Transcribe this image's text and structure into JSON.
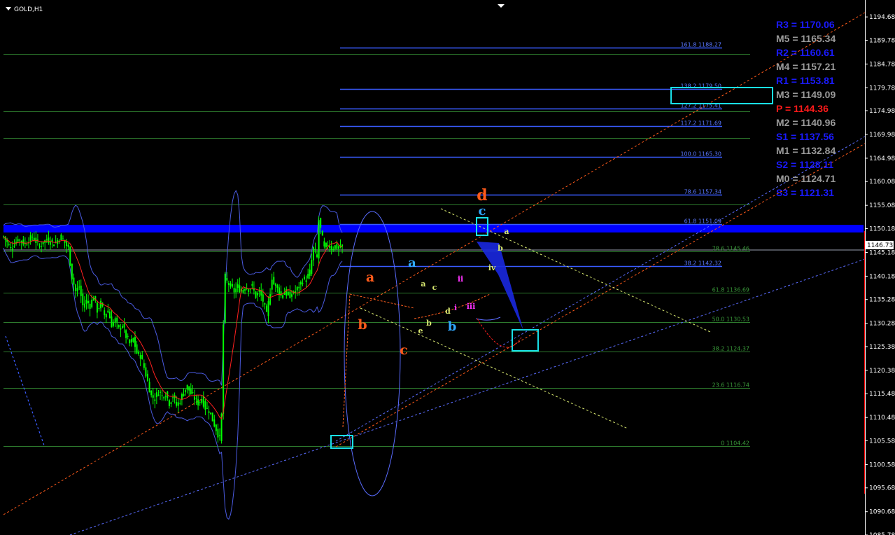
{
  "chart_data": {
    "type": "candlestick",
    "title": "GOLD,H1",
    "ylim": [
      1085.78,
      1197.5
    ],
    "y_ticks": [
      "1194.68",
      "1189.78",
      "1184.78",
      "1179.78",
      "1174.98",
      "1169.98",
      "1164.98",
      "1160.08",
      "1155.08",
      "1150.18",
      "1145.18",
      "1140.18",
      "1135.28",
      "1130.28",
      "1125.38",
      "1120.38",
      "1115.48",
      "1110.48",
      "1105.58",
      "1100.58",
      "1095.68",
      "1090.68",
      "1085.78"
    ],
    "current_price": "1146.73",
    "price_path": [
      [
        0,
        1148.5
      ],
      [
        4,
        1146
      ],
      [
        8,
        1148
      ],
      [
        12,
        1147
      ],
      [
        16,
        1148.5
      ],
      [
        20,
        1146.5
      ],
      [
        24,
        1148
      ],
      [
        28,
        1147
      ],
      [
        32,
        1148.5
      ],
      [
        36,
        1146
      ],
      [
        38,
        1140
      ],
      [
        40,
        1137
      ],
      [
        42,
        1138
      ],
      [
        44,
        1134
      ],
      [
        46,
        1135
      ],
      [
        48,
        1134
      ],
      [
        50,
        1136
      ],
      [
        52,
        1133
      ],
      [
        54,
        1134.5
      ],
      [
        56,
        1132
      ],
      [
        58,
        1133
      ],
      [
        60,
        1130
      ],
      [
        62,
        1131
      ],
      [
        64,
        1129
      ],
      [
        66,
        1130
      ],
      [
        68,
        1127.5
      ],
      [
        70,
        1126
      ],
      [
        72,
        1127
      ],
      [
        74,
        1124
      ],
      [
        76,
        1123.5
      ],
      [
        78,
        1121
      ],
      [
        80,
        1118
      ],
      [
        82,
        1115
      ],
      [
        84,
        1114.5
      ],
      [
        86,
        1116
      ],
      [
        88,
        1115
      ],
      [
        90,
        1115.5
      ],
      [
        92,
        1113.5
      ],
      [
        94,
        1115
      ],
      [
        96,
        1113
      ],
      [
        98,
        1114
      ],
      [
        100,
        1116
      ],
      [
        102,
        1117
      ],
      [
        104,
        1115.5
      ],
      [
        106,
        1114.5
      ],
      [
        108,
        1113.5
      ],
      [
        110,
        1114.5
      ],
      [
        112,
        1112.5
      ],
      [
        114,
        1112
      ],
      [
        116,
        1110
      ],
      [
        118,
        1108
      ],
      [
        120,
        1106
      ],
      [
        121,
        1111
      ],
      [
        122,
        1130
      ],
      [
        123,
        1140
      ],
      [
        124,
        1139
      ],
      [
        126,
        1138
      ],
      [
        128,
        1137
      ],
      [
        130,
        1138
      ],
      [
        132,
        1137
      ],
      [
        134,
        1138
      ],
      [
        136,
        1137.5
      ],
      [
        138,
        1138
      ],
      [
        140,
        1136
      ],
      [
        142,
        1137
      ],
      [
        144,
        1135
      ],
      [
        146,
        1132
      ],
      [
        148,
        1137
      ],
      [
        149,
        1140
      ],
      [
        150,
        1138.5
      ],
      [
        152,
        1138
      ],
      [
        154,
        1136
      ],
      [
        156,
        1137
      ],
      [
        158,
        1136
      ],
      [
        160,
        1136.5
      ],
      [
        162,
        1137
      ],
      [
        164,
        1138
      ],
      [
        166,
        1139.5
      ],
      [
        168,
        1139.5
      ],
      [
        170,
        1141
      ],
      [
        172,
        1146
      ],
      [
        174,
        1144
      ],
      [
        175,
        1152
      ],
      [
        177,
        1148
      ],
      [
        178,
        1146
      ],
      [
        180,
        1147
      ],
      [
        182,
        1146
      ],
      [
        184,
        1146.5
      ],
      [
        186,
        1146
      ],
      [
        188,
        1146.5
      ]
    ],
    "fibonacci_levels": [
      {
        "label": "161.8 1188.27",
        "price": 1188.27,
        "set": "blue"
      },
      {
        "label": "138.2 1179.50",
        "price": 1179.5,
        "set": "blue"
      },
      {
        "label": "127.2 1175.41",
        "price": 1175.41,
        "set": "blue"
      },
      {
        "label": "117.2 1171.69",
        "price": 1171.69,
        "set": "blue"
      },
      {
        "label": "100.0  1165.30",
        "price": 1165.3,
        "set": "blue"
      },
      {
        "label": "78.6 1157.34",
        "price": 1157.34,
        "set": "blue"
      },
      {
        "label": "61.8 1151.09",
        "price": 1151.09,
        "set": "blue"
      },
      {
        "label": "38.2 1142.32",
        "price": 1142.32,
        "set": "blue"
      },
      {
        "label": "78.6 1145.46",
        "price": 1145.46,
        "set": "green"
      },
      {
        "label": "61.8 1136.69",
        "price": 1136.69,
        "set": "green"
      },
      {
        "label": "50.0 1130.53",
        "price": 1130.53,
        "set": "green"
      },
      {
        "label": "38.2 1124.37",
        "price": 1124.37,
        "set": "green"
      },
      {
        "label": "23.6 1116.74",
        "price": 1116.74,
        "set": "green"
      },
      {
        "label": "0 1104.42",
        "price": 1104.42,
        "set": "green"
      }
    ],
    "pivot_levels": [
      {
        "name": "R3",
        "label": "R3 = 1170.06",
        "price": 1170.06,
        "color": "#1a1aff"
      },
      {
        "name": "M5",
        "label": "M5 = 1165.34",
        "price": 1165.34,
        "color": "#9a9a9a"
      },
      {
        "name": "R2",
        "label": "R2 = 1160.61",
        "price": 1160.61,
        "color": "#1a1aff"
      },
      {
        "name": "M4",
        "label": "M4 = 1157.21",
        "price": 1157.21,
        "color": "#9a9a9a"
      },
      {
        "name": "R1",
        "label": "R1 = 1153.81",
        "price": 1153.81,
        "color": "#1a1aff"
      },
      {
        "name": "M3",
        "label": "M3 = 1149.09",
        "price": 1149.09,
        "color": "#9a9a9a"
      },
      {
        "name": "P",
        "label": "P  = 1144.36",
        "price": 1144.36,
        "color": "#ff1a1a"
      },
      {
        "name": "M2",
        "label": "M2 = 1140.96",
        "price": 1140.96,
        "color": "#9a9a9a"
      },
      {
        "name": "S1",
        "label": "S1 = 1137.56",
        "price": 1137.56,
        "color": "#1a1aff"
      },
      {
        "name": "M1",
        "label": "M1 = 1132.84",
        "price": 1132.84,
        "color": "#9a9a9a"
      },
      {
        "name": "S2",
        "label": "S2 = 1128.11",
        "price": 1128.11,
        "color": "#1a1aff"
      },
      {
        "name": "M0",
        "label": "M0 = 1124.71",
        "price": 1124.71,
        "color": "#9a9a9a"
      },
      {
        "name": "S3",
        "label": "S3 = 1121.31",
        "price": 1121.31,
        "color": "#1a1aff"
      }
    ],
    "wave_labels": [
      "a",
      "b",
      "c",
      "d",
      "a",
      "b",
      "c",
      "a",
      "b",
      "c",
      "d",
      "e",
      "i",
      "ii",
      "iii",
      "iv",
      "a",
      "b"
    ],
    "colors": {
      "background": "#000000",
      "candles": "#00ff00",
      "fib_blue": "#3a5cff",
      "fib_green": "#2d7a2d",
      "resistance_band": "#0000ff",
      "channel_orange": "#ff5a1a",
      "channel_blue": "#5a6cff",
      "target_box": "#19e0e8",
      "axis": "#ff0000"
    }
  }
}
